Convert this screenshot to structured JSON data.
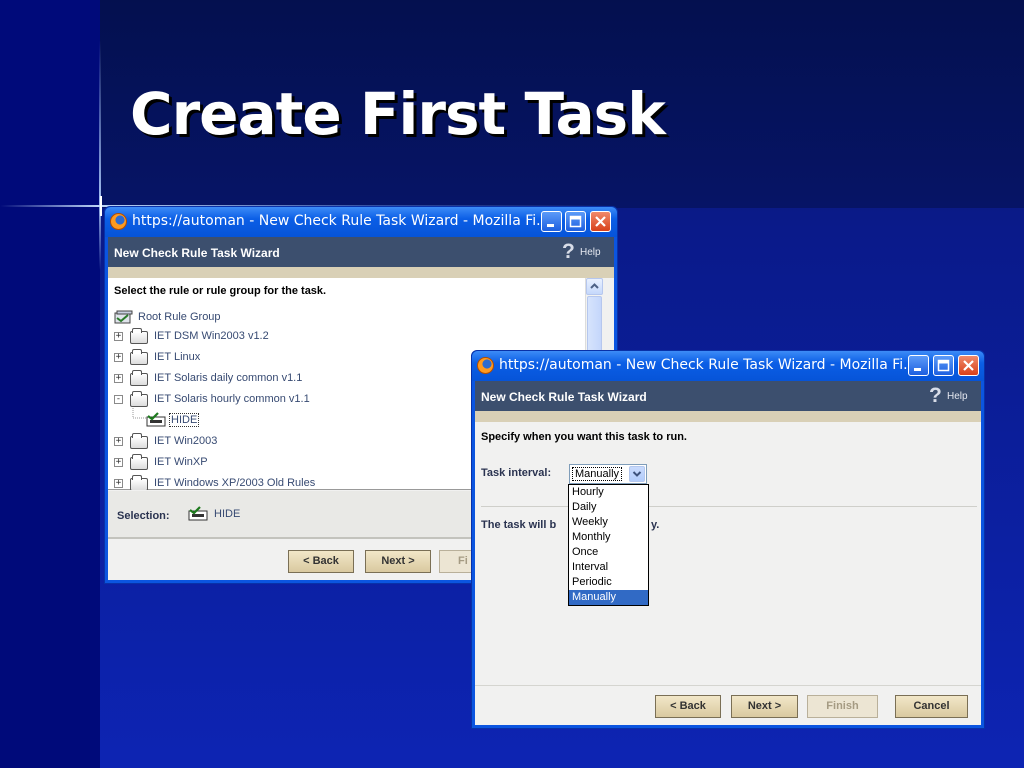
{
  "slide": {
    "title": "Create First Task"
  },
  "window1": {
    "title": "https://automan - New Check Rule Task Wizard - Mozilla Fi...",
    "header_title": "New Check Rule Task Wizard",
    "help_label": "Help",
    "instruction": "Select the rule or rule group for the task.",
    "tree": {
      "root_label": "Root Rule Group",
      "items": [
        {
          "label": "IET DSM Win2003 v1.2",
          "expander": "+"
        },
        {
          "label": "IET Linux",
          "expander": "+"
        },
        {
          "label": "IET Solaris daily common v1.1",
          "expander": "+"
        },
        {
          "label": "IET Solaris hourly common v1.1",
          "expander": "-"
        },
        {
          "label": "HIDE",
          "child": true
        },
        {
          "label": "IET Win2003",
          "expander": "+"
        },
        {
          "label": "IET WinXP",
          "expander": "+"
        },
        {
          "label": "IET Windows XP/2003 Old Rules",
          "expander": "+"
        }
      ]
    },
    "selection_label": "Selection:",
    "selection_value": "HIDE",
    "buttons": {
      "back": "< Back",
      "next": "Next >",
      "finish": "Fi"
    }
  },
  "window2": {
    "title": "https://automan - New Check Rule Task Wizard - Mozilla Fi...",
    "header_title": "New Check Rule Task Wizard",
    "help_label": "Help",
    "instruction": "Specify when you want this task to run.",
    "interval_label": "Task interval:",
    "interval_value": "Manually",
    "interval_options": [
      "Hourly",
      "Daily",
      "Weekly",
      "Monthly",
      "Once",
      "Interval",
      "Periodic",
      "Manually"
    ],
    "task_note_start": "The task will b",
    "task_note_end": "y.",
    "buttons": {
      "back": "< Back",
      "next": "Next >",
      "finish": "Finish",
      "cancel": "Cancel"
    }
  }
}
